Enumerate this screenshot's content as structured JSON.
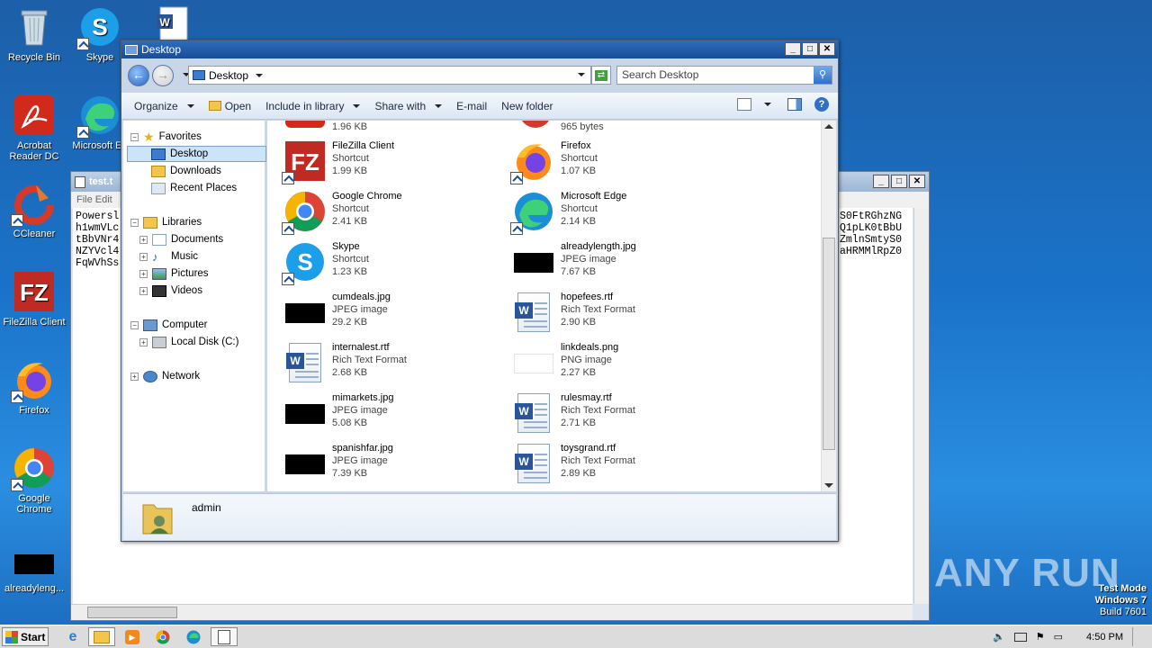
{
  "desktop": {
    "icons": [
      {
        "label": "Recycle Bin"
      },
      {
        "label": "Skype"
      },
      {
        "label": "Acrobat Reader DC"
      },
      {
        "label": "Microsoft Ed"
      },
      {
        "label": "CCleaner"
      },
      {
        "label": "FileZilla Client"
      },
      {
        "label": "Firefox"
      },
      {
        "label": "Google Chrome"
      },
      {
        "label": "alreadyleng..."
      }
    ],
    "watermark": "ANY RUN",
    "testmode": {
      "line1": "Test Mode",
      "line2": "Windows 7",
      "line3": "Build 7601"
    }
  },
  "notepad": {
    "title": "test.t",
    "menu": "File  Edit",
    "left_lines": [
      "Powersl",
      "h1wmVLc",
      "tBbVNr4",
      "NZYVcl4",
      "FqWVhSs"
    ],
    "right_lines": [
      "S0FtRGhzNG",
      "Q1pLK0tBbU",
      "ZmlnSmtyS0",
      "aHRMMlRpZ0",
      ""
    ]
  },
  "explorer": {
    "title": "Desktop",
    "address": "Desktop",
    "search_placeholder": "Search Desktop",
    "toolbar": {
      "organize": "Organize",
      "open": "Open",
      "include": "Include in library",
      "share": "Share with",
      "email": "E-mail",
      "newfolder": "New folder"
    },
    "nav": {
      "favorites": "Favorites",
      "desktop": "Desktop",
      "downloads": "Downloads",
      "recent": "Recent Places",
      "libraries": "Libraries",
      "documents": "Documents",
      "music": "Music",
      "pictures": "Pictures",
      "videos": "Videos",
      "computer": "Computer",
      "localdisk": "Local Disk (C:)",
      "network": "Network"
    },
    "top_partial": {
      "left_size": "1.96 KB",
      "right_size": "965 bytes"
    },
    "items": [
      {
        "name": "FileZilla Client",
        "type": "Shortcut",
        "size": "1.99 KB"
      },
      {
        "name": "Firefox",
        "type": "Shortcut",
        "size": "1.07 KB"
      },
      {
        "name": "Google Chrome",
        "type": "Shortcut",
        "size": "2.41 KB"
      },
      {
        "name": "Microsoft Edge",
        "type": "Shortcut",
        "size": "2.14 KB"
      },
      {
        "name": "Skype",
        "type": "Shortcut",
        "size": "1.23 KB"
      },
      {
        "name": "alreadylength.jpg",
        "type": "JPEG image",
        "size": "7.67 KB"
      },
      {
        "name": "cumdeals.jpg",
        "type": "JPEG image",
        "size": "29.2 KB"
      },
      {
        "name": "hopefees.rtf",
        "type": "Rich Text Format",
        "size": "2.90 KB"
      },
      {
        "name": "internalest.rtf",
        "type": "Rich Text Format",
        "size": "2.68 KB"
      },
      {
        "name": "linkdeals.png",
        "type": "PNG image",
        "size": "2.27 KB"
      },
      {
        "name": "mimarkets.jpg",
        "type": "JPEG image",
        "size": "5.08 KB"
      },
      {
        "name": "rulesmay.rtf",
        "type": "Rich Text Format",
        "size": "2.71 KB"
      },
      {
        "name": "spanishfar.jpg",
        "type": "JPEG image",
        "size": "7.39 KB"
      },
      {
        "name": "toysgrand.rtf",
        "type": "Rich Text Format",
        "size": "2.89 KB"
      }
    ],
    "details_name": "admin"
  },
  "taskbar": {
    "start": "Start",
    "clock": "4:50 PM"
  }
}
